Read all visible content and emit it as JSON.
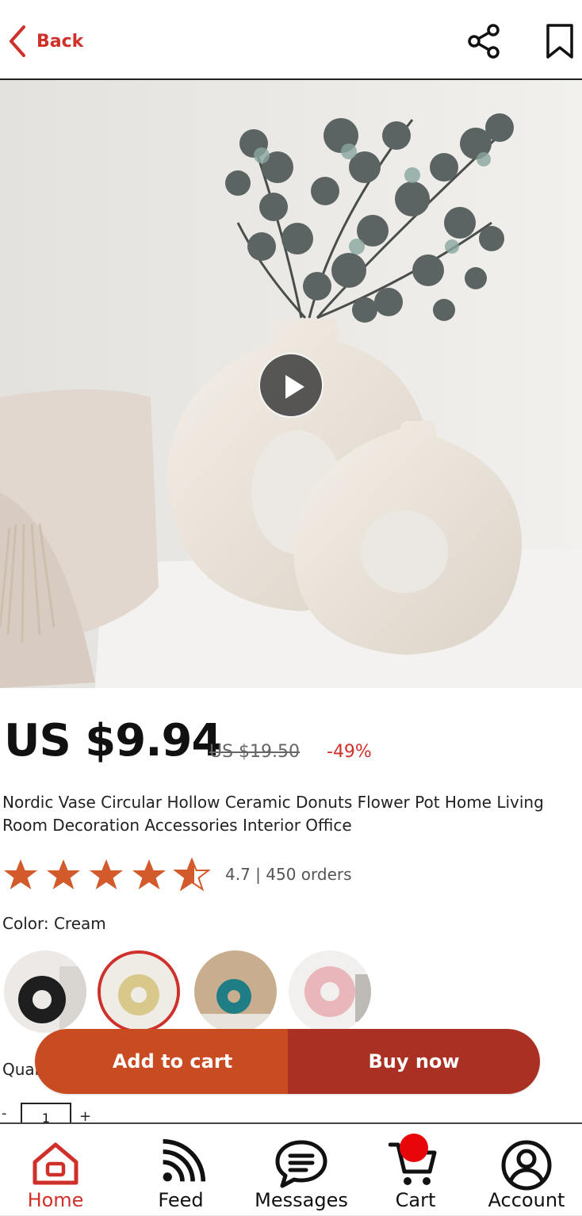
{
  "header": {
    "back_label": "Back",
    "accent_color": "#d0302a"
  },
  "product": {
    "price": "US $9.94",
    "original_price": "US $19.50",
    "discount": "-49%",
    "title": "Nordic Vase Circular Hollow Ceramic Donuts Flower Pot Home Living Room Decoration Accessories Interior Office",
    "rating_value": 4.7,
    "rating_text": "4.7 | 450 orders",
    "stars_max": 5
  },
  "color": {
    "label": "Color: Cream",
    "options": [
      {
        "name": "black",
        "hex": "#1e1e1e",
        "selected": false
      },
      {
        "name": "cream",
        "hex": "#d8c98a",
        "selected": true
      },
      {
        "name": "teal",
        "hex": "#1f7d86",
        "selected": false
      },
      {
        "name": "pink",
        "hex": "#e8b6bb",
        "selected": false
      }
    ]
  },
  "quantity": {
    "label": "Quantity",
    "minus": "-",
    "value": "1",
    "plus": "+"
  },
  "actions": {
    "add_to_cart": "Add to cart",
    "buy_now": "Buy now",
    "add_color": "#c84b22",
    "buy_color": "#a93022"
  },
  "nav": {
    "items": [
      {
        "label": "Home",
        "icon": "home-icon",
        "active": true
      },
      {
        "label": "Feed",
        "icon": "feed-icon",
        "active": false
      },
      {
        "label": "Messages",
        "icon": "messages-icon",
        "active": false
      },
      {
        "label": "Cart",
        "icon": "cart-icon",
        "active": false
      },
      {
        "label": "Account",
        "icon": "account-icon",
        "active": false
      }
    ],
    "cart_badge_color": "#e8060a"
  }
}
